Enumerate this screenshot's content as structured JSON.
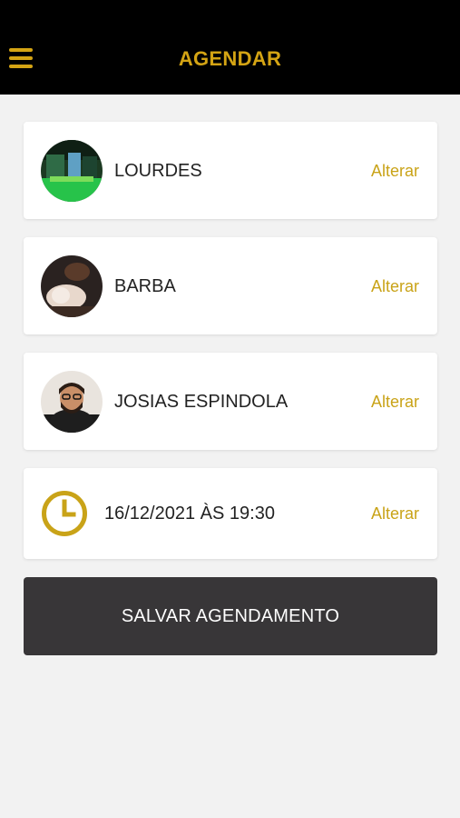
{
  "header": {
    "title": "AGENDAR",
    "accent_color": "#d4a414",
    "menu_icon": "hamburger-menu-icon"
  },
  "booking": {
    "location": {
      "label": "LOURDES",
      "action": "Alterar"
    },
    "service": {
      "label": "BARBA",
      "action": "Alterar"
    },
    "professional": {
      "label": "JOSIAS ESPINDOLA",
      "action": "Alterar"
    },
    "datetime": {
      "label": "16/12/2021 ÀS 19:30",
      "action": "Alterar",
      "icon": "clock-icon"
    }
  },
  "save_button": {
    "label": "SALVAR AGENDAMENTO"
  }
}
